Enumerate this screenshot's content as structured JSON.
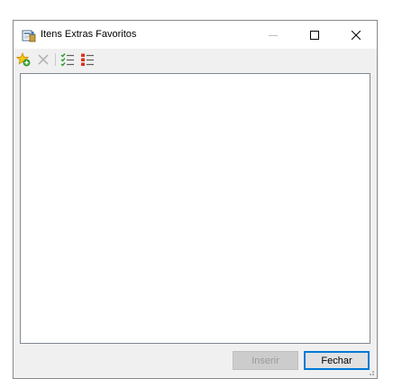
{
  "window": {
    "title": "Itens Extras Favoritos",
    "controls": {
      "minimize": "minimize-icon",
      "maximize": "maximize-icon",
      "close": "close-icon"
    }
  },
  "toolbar": {
    "buttons": [
      {
        "name": "add-favorite",
        "icon": "star-add-icon",
        "enabled": true
      },
      {
        "name": "delete",
        "icon": "delete-x-icon",
        "enabled": false
      },
      {
        "name": "check-all",
        "icon": "check-list-icon",
        "enabled": true
      },
      {
        "name": "uncheck-all",
        "icon": "uncheck-list-icon",
        "enabled": true
      }
    ]
  },
  "list": {
    "items": []
  },
  "buttons": {
    "insert_label": "Inserir",
    "close_label": "Fechar"
  },
  "colors": {
    "accent": "#0078d7",
    "window_bg": "#f0f0f0"
  }
}
